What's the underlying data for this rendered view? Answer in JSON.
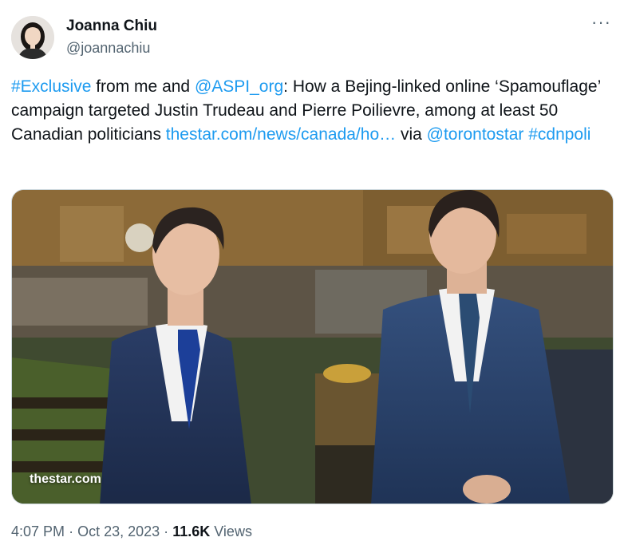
{
  "author": {
    "name": "Joanna Chiu",
    "handle": "@joannachiu"
  },
  "tweet": {
    "hashtag_exclusive": "#Exclusive",
    "text_part1": " from me and ",
    "mention_aspi": "@ASPI_org",
    "text_part2": ": How a Bejing-linked online ‘Spamouflage’ campaign targeted Justin Trudeau and Pierre Poilievre, among at least 50 Canadian politicians ",
    "link": "thestar.com/news/canada/ho…",
    "text_part3": " via ",
    "mention_star": "@torontostar",
    "hashtag_cdnpoli": "#cdnpoli"
  },
  "media": {
    "watermark": "thestar.com",
    "alt_description_icon": "photo"
  },
  "meta": {
    "time": "4:07 PM",
    "date": "Oct 23, 2023",
    "views_count": "11.6K",
    "views_label": "Views",
    "sep": "·"
  },
  "icons": {
    "more": "more-icon"
  },
  "colors": {
    "link": "#1d9bf0",
    "secondary_text": "#536471",
    "primary_text": "#0f1419"
  }
}
